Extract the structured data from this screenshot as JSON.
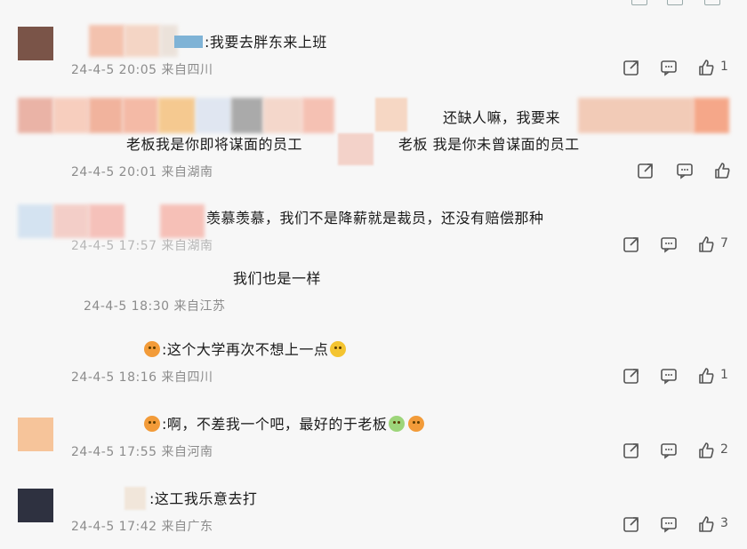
{
  "comments": [
    {
      "text": ":我要去胖东来上班",
      "meta": "24-4-5 20:05 来自四川",
      "likes": "1"
    },
    {
      "text1": "还缺人嘛，我要来",
      "text2": "老板我是你即将谋面的员工",
      "text3": "老板 我是你未曾谋面的员工",
      "meta": "24-4-5 20:01 来自湖南",
      "likes": ""
    },
    {
      "text": "羡慕羡慕，我们不是降薪就是裁员，还没有赔偿那种",
      "meta": "24-4-5 17:57 来自湖南",
      "likes": "7"
    },
    {
      "text": "我们也是一样",
      "meta": "24-4-5 18:30 来自江苏",
      "likes": ""
    },
    {
      "text": ":这个大学再次不想上一点",
      "meta": "24-4-5 18:16 来自四川",
      "likes": "1"
    },
    {
      "text": ":啊，不差我一个吧，最好的于老板",
      "meta": "24-4-5 17:55 来自河南",
      "likes": "2"
    },
    {
      "text": ":这工我乐意去打",
      "meta": "24-4-5 17:42 来自广东",
      "likes": "3"
    }
  ],
  "icons": {
    "share": "share-icon",
    "comment": "comment-icon",
    "like": "thumbs-up-icon"
  },
  "colors": {
    "meta": "#8c8c8c",
    "icon": "#555555",
    "background": "#f7f7f7"
  }
}
